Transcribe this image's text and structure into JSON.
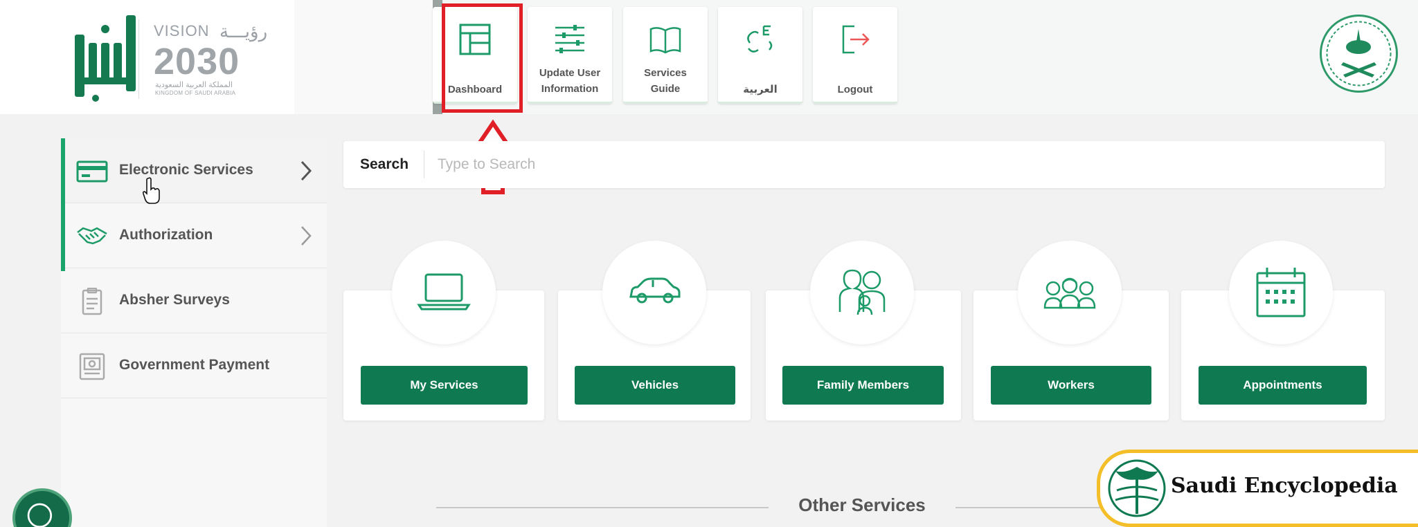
{
  "header": {
    "vision": {
      "title": "VISION",
      "title_ar": "رؤيـــة",
      "year": "2030",
      "subtitle_ar": "المملكة العربية السعودية",
      "subtitle_en": "KINGDOM OF SAUDI ARABIA"
    },
    "nav": [
      {
        "label": "Dashboard",
        "icon": "dashboard-icon"
      },
      {
        "label": "Update User\nInformation",
        "icon": "sliders-icon"
      },
      {
        "label": "Services\nGuide",
        "icon": "book-icon"
      },
      {
        "label": "العربية",
        "icon": "language-icon"
      },
      {
        "label": "Logout",
        "icon": "logout-icon"
      }
    ],
    "highlighted": "Dashboard"
  },
  "sidebar": {
    "items": [
      {
        "label": "Electronic Services",
        "icon": "card-icon",
        "chevron": true,
        "active": true
      },
      {
        "label": "Authorization",
        "icon": "handshake-icon",
        "chevron": true
      },
      {
        "label": "Absher Surveys",
        "icon": "clipboard-icon",
        "chevron": false
      },
      {
        "label": "Government Payment",
        "icon": "payment-icon",
        "chevron": false
      }
    ]
  },
  "search": {
    "label": "Search",
    "placeholder": "Type to Search",
    "value": ""
  },
  "cards": [
    {
      "label": "My Services",
      "icon": "laptop-icon"
    },
    {
      "label": "Vehicles",
      "icon": "car-icon"
    },
    {
      "label": "Family Members",
      "icon": "family-icon"
    },
    {
      "label": "Workers",
      "icon": "workers-icon"
    },
    {
      "label": "Appointments",
      "icon": "calendar-icon"
    }
  ],
  "other_services": {
    "title": "Other Services"
  },
  "watermark": {
    "text": "Saudi Encyclopedia"
  },
  "colors": {
    "primary": "#0f7a52",
    "accent": "#1aa36a",
    "highlight": "#e11f27",
    "watermark_border": "#f3be28"
  }
}
